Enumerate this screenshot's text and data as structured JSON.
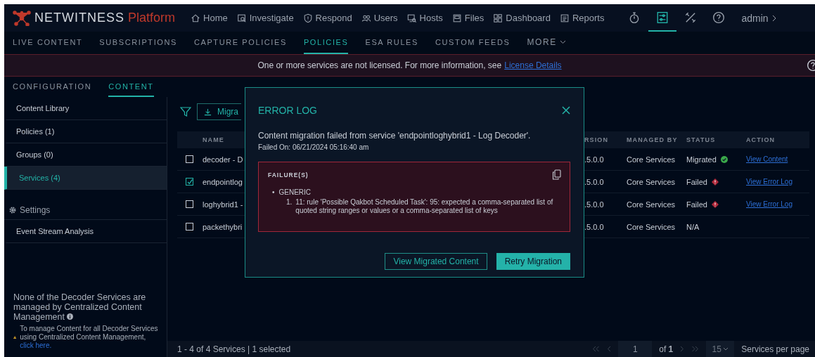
{
  "header": {
    "brand": "NETWITNESS",
    "product": "Platform",
    "nav": [
      {
        "label": "Home",
        "selected": false
      },
      {
        "label": "Investigate",
        "selected": false
      },
      {
        "label": "Respond",
        "selected": false
      },
      {
        "label": "Users",
        "selected": false
      },
      {
        "label": "Hosts",
        "selected": false
      },
      {
        "label": "Files",
        "selected": false
      },
      {
        "label": "Dashboard",
        "selected": false
      },
      {
        "label": "Reports",
        "selected": false
      }
    ],
    "tools": [
      {
        "kind": "timer",
        "selected": false
      },
      {
        "kind": "config",
        "selected": true
      },
      {
        "kind": "tools",
        "selected": false
      },
      {
        "kind": "help",
        "selected": false
      }
    ],
    "user": "admin"
  },
  "subnav": [
    {
      "label": "LIVE CONTENT",
      "selected": false
    },
    {
      "label": "SUBSCRIPTIONS",
      "selected": false
    },
    {
      "label": "CAPTURE POLICIES",
      "selected": false
    },
    {
      "label": "POLICIES",
      "selected": true
    },
    {
      "label": "ESA RULES",
      "selected": false
    },
    {
      "label": "CUSTOM FEEDS",
      "selected": false
    },
    {
      "label": "MORE",
      "selected": false,
      "menu": true
    }
  ],
  "banner": {
    "text": "One or more services are not licensed. For more information, see",
    "link": "License Details"
  },
  "tabs": [
    {
      "label": "CONFIGURATION",
      "selected": false
    },
    {
      "label": "CONTENT",
      "selected": true
    }
  ],
  "sidebar": {
    "items": [
      {
        "label": "Content Library",
        "selected": false
      },
      {
        "label": "Policies (1)",
        "selected": false
      },
      {
        "label": "Groups (0)",
        "selected": false
      },
      {
        "label": "Services (4)",
        "selected": true
      }
    ],
    "section": "Settings",
    "section_items": [
      {
        "label": "Event Stream Analysis",
        "selected": false
      }
    ],
    "note": {
      "title": "None of the Decoder Services are managed by Centralized Content Management",
      "text": "To manage Content for all Decoder Services using Centralized Content Management,",
      "link": "click here."
    }
  },
  "toolbar": {
    "migrate_button": "Migra"
  },
  "table": {
    "columns": {
      "name": "NAME",
      "version": "RSION",
      "managed_by": "MANAGED BY",
      "status": "STATUS",
      "action": "ACTION"
    },
    "rows": [
      {
        "checked": false,
        "name": "decoder - D",
        "version": ".5.0.0",
        "managed_by": "Core Services",
        "status": "Migrated",
        "kind": "migrated",
        "action": "View Content"
      },
      {
        "checked": true,
        "name": "endpointlog",
        "version": ".5.0.0",
        "managed_by": "Core Services",
        "status": "Failed",
        "kind": "failed",
        "action": "View Error Log"
      },
      {
        "checked": false,
        "name": "loghybrid1 -",
        "version": ".5.0.0",
        "managed_by": "Core Services",
        "status": "Failed",
        "kind": "failed",
        "action": "View Error Log"
      },
      {
        "checked": false,
        "name": "packethybri",
        "version": ".5.0.0",
        "managed_by": "Core Services",
        "status": "N/A",
        "kind": "none"
      }
    ]
  },
  "footer": {
    "summary": "1 - 4 of 4 Services | 1 selected",
    "page": "1",
    "of": "of",
    "total": "1",
    "per_page": "15",
    "per_page_label": "Services per page"
  },
  "modal": {
    "title": "ERROR LOG",
    "message": "Content migration failed from service 'endpointloghybrid1 - Log Decoder'.",
    "failed_on": "Failed On: 06/21/2024 05:16:40 am",
    "failure": {
      "heading": "FAILURE(S)",
      "bullet": "•",
      "category": "GENERIC",
      "items": [
        {
          "marker": "1.",
          "text": "11: rule 'Possible Qakbot Scheduled Task': 95: expected a comma-separated list of quoted string ranges or values or a comma-separated list of keys"
        }
      ]
    },
    "buttons": [
      {
        "label": "View Migrated Content",
        "kind": "outline"
      },
      {
        "label": "Retry Migration",
        "kind": "primary"
      }
    ]
  }
}
